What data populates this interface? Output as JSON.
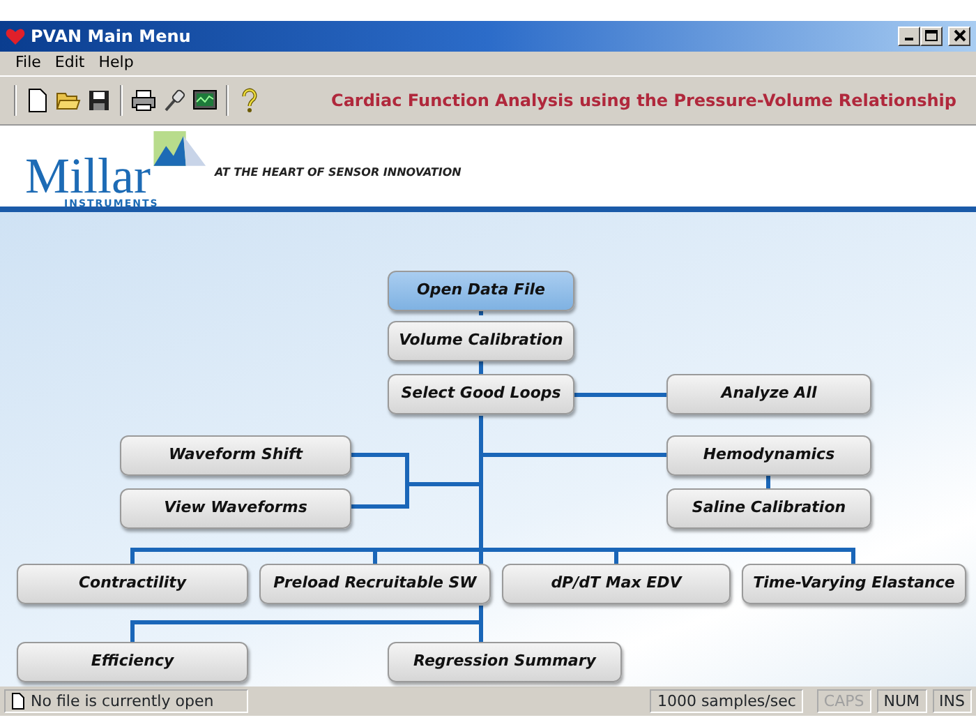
{
  "window": {
    "title": "PVAN Main Menu"
  },
  "menu": [
    "File",
    "Edit",
    "Help"
  ],
  "toolbar": {
    "caption": "Cardiac Function Analysis using the Pressure-Volume Relationship"
  },
  "banner": {
    "logo_name": "Millar",
    "logo_sub": "INSTRUMENTS",
    "tagline": "AT THE HEART OF SENSOR INNOVATION"
  },
  "flowchart": [
    {
      "label": "Open Data File",
      "selected": true
    },
    {
      "label": "Volume Calibration",
      "selected": false
    },
    {
      "label": "Select Good Loops",
      "selected": false
    },
    {
      "label": "Analyze All",
      "selected": false
    },
    {
      "label": "Waveform Shift",
      "selected": false
    },
    {
      "label": "Hemodynamics",
      "selected": false
    },
    {
      "label": "View Waveforms",
      "selected": false
    },
    {
      "label": "Saline Calibration",
      "selected": false
    },
    {
      "label": "Contractility",
      "selected": false
    },
    {
      "label": "Preload Recruitable SW",
      "selected": false
    },
    {
      "label": "dP/dT Max EDV",
      "selected": false
    },
    {
      "label": "Time-Varying Elastance",
      "selected": false
    },
    {
      "label": "Efficiency",
      "selected": false
    },
    {
      "label": "Regression Summary",
      "selected": false
    }
  ],
  "status_bar": {
    "message": "No file is currently open",
    "rate": "1000 samples/sec",
    "indicators": [
      {
        "label": "CAPS",
        "disabled": true
      },
      {
        "label": "NUM",
        "disabled": false
      },
      {
        "label": "INS",
        "disabled": false
      }
    ]
  }
}
